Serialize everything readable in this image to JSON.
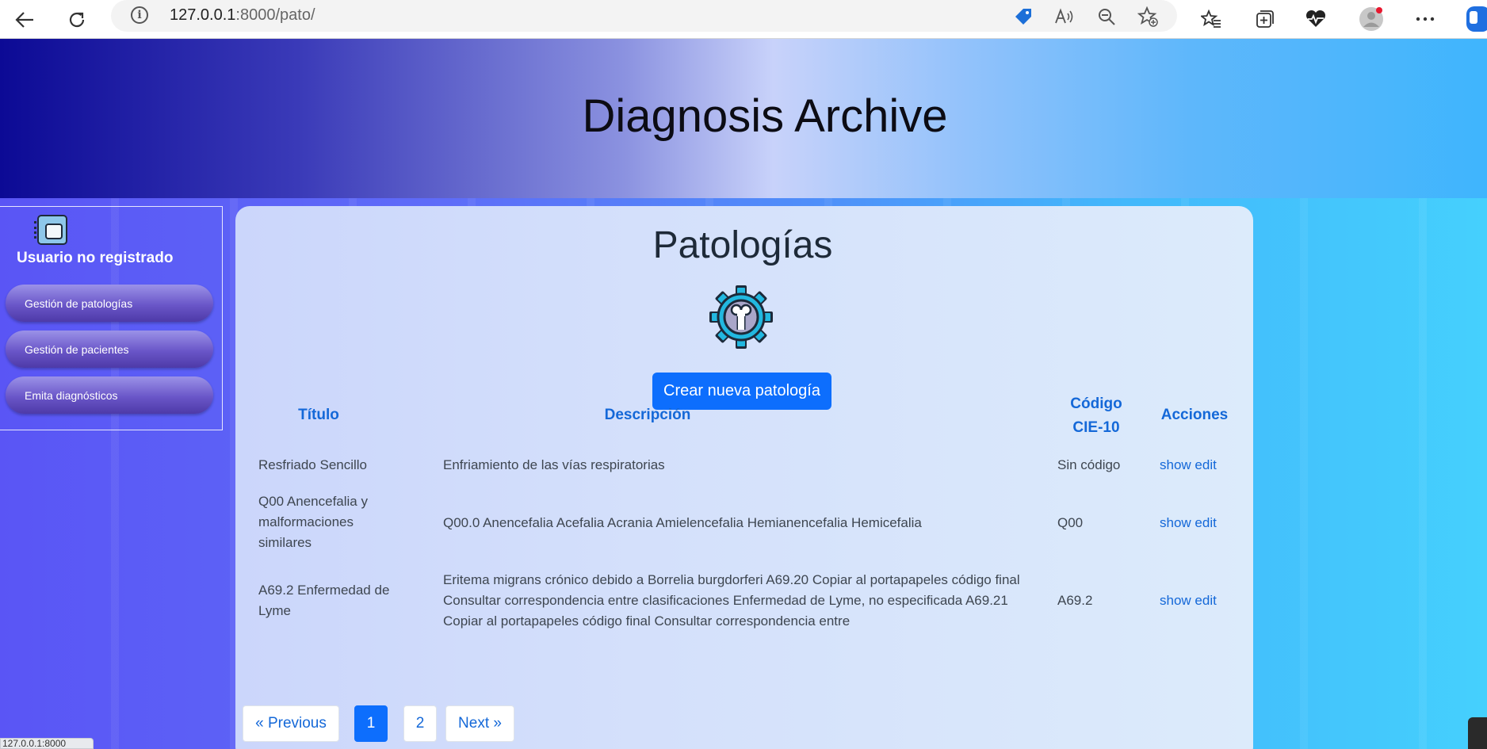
{
  "browser": {
    "url_host": "127.0.0.1",
    "url_rest": ":8000/pato/",
    "status_url": "127.0.0.1:8000"
  },
  "header": {
    "title": "Diagnosis Archive"
  },
  "sidebar": {
    "user": "Usuario no registrado",
    "items": [
      {
        "label": "Gestión de patologías"
      },
      {
        "label": "Gestión de pacientes"
      },
      {
        "label": "Emita diagnósticos"
      }
    ]
  },
  "main": {
    "title": "Patologías",
    "create_button": "Crear nueva patología",
    "columns": {
      "titulo": "Título",
      "descripcion": "Descripción",
      "codigo": "Código CIE-10",
      "acciones": "Acciones"
    },
    "rows": [
      {
        "titulo": "Resfriado Sencillo",
        "descripcion": "Enfriamiento de las vías respiratorias",
        "codigo": "Sin código",
        "show": "show",
        "edit": "edit"
      },
      {
        "titulo": "Q00 Anencefalia y malformaciones similares",
        "descripcion": "Q00.0 Anencefalia Acefalia Acrania Amielencefalia Hemianencefalia Hemicefalia",
        "codigo": "Q00",
        "show": "show",
        "edit": "edit"
      },
      {
        "titulo": "A69.2 Enfermedad de Lyme",
        "descripcion": "Eritema migrans crónico debido a Borrelia burgdorferi A69.20 Copiar al portapapeles código final Consultar correspondencia entre clasificaciones Enfermedad de Lyme, no especificada A69.21 Copiar al portapapeles código final Consultar correspondencia entre",
        "codigo": "A69.2",
        "show": "show",
        "edit": "edit"
      }
    ],
    "pagination": {
      "previous": "« Previous",
      "pages": [
        "1",
        "2"
      ],
      "current": "1",
      "next": "Next »"
    }
  },
  "colors": {
    "primary": "#0d6efd",
    "link": "#1468d8",
    "sidebar_button": "#6a56c8"
  }
}
